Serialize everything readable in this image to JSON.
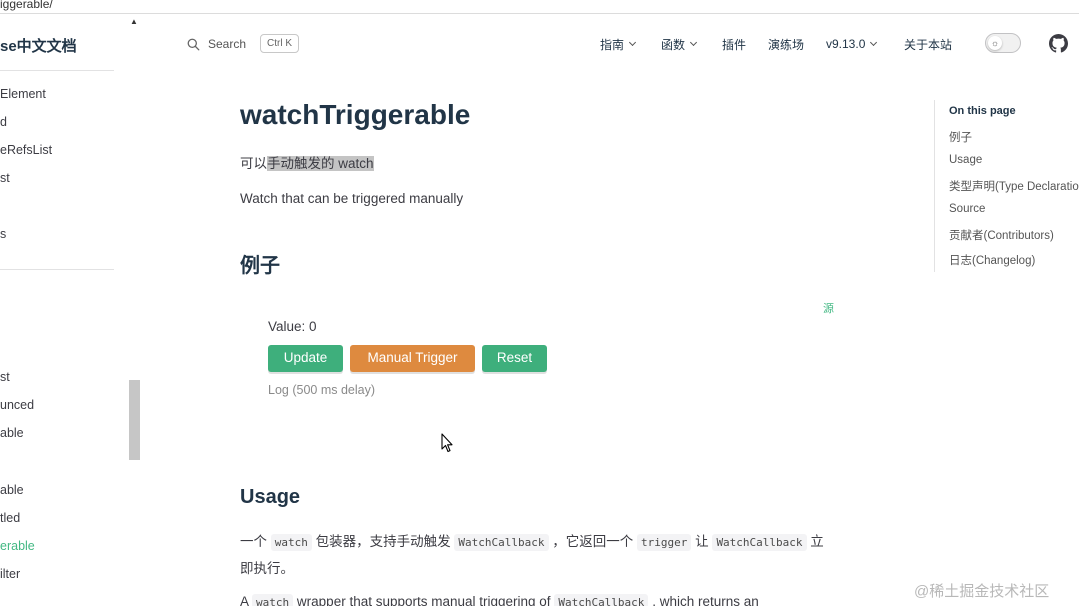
{
  "url": {
    "text": "iggerable/"
  },
  "sidebar": {
    "brand": "se中文文档",
    "items": [
      {
        "label": "Element",
        "active": false
      },
      {
        "label": "d",
        "active": false
      },
      {
        "label": "eRefsList",
        "active": false
      },
      {
        "label": "st",
        "active": false
      },
      {
        "label": "s",
        "active": false
      },
      {
        "label": "st",
        "active": false
      },
      {
        "label": "unced",
        "active": false
      },
      {
        "label": "able",
        "active": false
      },
      {
        "label": "able",
        "active": false
      },
      {
        "label": "tled",
        "active": false
      },
      {
        "label": "erable",
        "active": true
      },
      {
        "label": "ilter",
        "active": false
      }
    ]
  },
  "header": {
    "search_label": "Search",
    "search_shortcut": "Ctrl K",
    "nav": [
      {
        "label": "指南",
        "dropdown": true
      },
      {
        "label": "函数",
        "dropdown": true
      },
      {
        "label": "插件",
        "dropdown": false
      },
      {
        "label": "演练场",
        "dropdown": false
      },
      {
        "label": "v9.13.0",
        "dropdown": true
      },
      {
        "label": "关于本站",
        "dropdown": false
      }
    ]
  },
  "main": {
    "title": "watchTriggerable",
    "desc_cn_prefix": "可以",
    "desc_cn_highlight": "手动触发的 watch",
    "desc_en": "Watch that can be triggered manually",
    "example_heading": "例子",
    "demo": {
      "source_link": "源",
      "value_text": "Value: 0",
      "buttons": {
        "update": "Update",
        "manual_trigger": "Manual Trigger",
        "reset": "Reset"
      },
      "log": "Log (500 ms delay)"
    },
    "usage_heading": "Usage",
    "usage_cn": {
      "t1": "一个",
      "c1": "watch",
      "t2": "包装器，支持手动触发",
      "c2": "WatchCallback",
      "t3": "，它返回一个",
      "c3": "trigger",
      "t4": "让",
      "c4": "WatchCallback",
      "t5": "立",
      "line2": "即执行。"
    },
    "usage_en": {
      "t1": "A",
      "c1": "watch",
      "t2": "wrapper that supports manual triggering of",
      "c2": "WatchCallback",
      "t3": ", which returns an"
    }
  },
  "toc": {
    "title": "On this page",
    "items": [
      "例子",
      "Usage",
      "类型声明(Type Declaratio",
      "Source",
      "贡献者(Contributors)",
      "日志(Changelog)"
    ]
  },
  "watermark": "@稀土掘金技术社区",
  "colors": {
    "accent": "#42b883",
    "button_green": "#3eaf7c",
    "button_orange": "#de8a3f",
    "heading": "#213547",
    "text": "#3c3c43"
  },
  "icons": {
    "search": "search-icon",
    "github": "github-icon",
    "theme": "sun-icon",
    "cursor": "mouse-cursor-icon"
  }
}
